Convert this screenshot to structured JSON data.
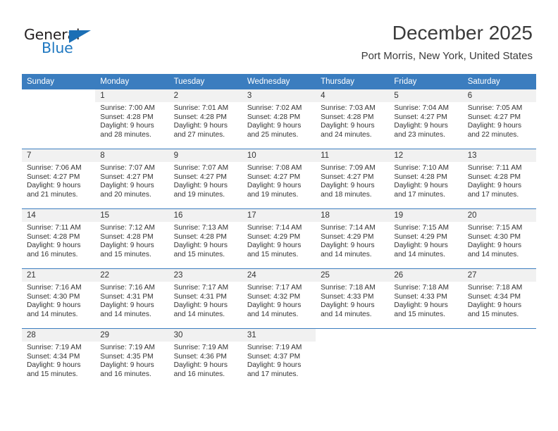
{
  "brand": {
    "name_part1": "General",
    "name_part2": "Blue",
    "accent_color": "#1b6fb5"
  },
  "header": {
    "title": "December 2025",
    "subtitle": "Port Morris, New York, United States"
  },
  "calendar": {
    "header_color": "#3b7dbf",
    "daynum_band_color": "#f1f1f1",
    "weekday_names": [
      "Sunday",
      "Monday",
      "Tuesday",
      "Wednesday",
      "Thursday",
      "Friday",
      "Saturday"
    ],
    "weeks": [
      [
        {
          "day": "",
          "lines": []
        },
        {
          "day": "1",
          "lines": [
            "Sunrise: 7:00 AM",
            "Sunset: 4:28 PM",
            "Daylight: 9 hours",
            "and 28 minutes."
          ]
        },
        {
          "day": "2",
          "lines": [
            "Sunrise: 7:01 AM",
            "Sunset: 4:28 PM",
            "Daylight: 9 hours",
            "and 27 minutes."
          ]
        },
        {
          "day": "3",
          "lines": [
            "Sunrise: 7:02 AM",
            "Sunset: 4:28 PM",
            "Daylight: 9 hours",
            "and 25 minutes."
          ]
        },
        {
          "day": "4",
          "lines": [
            "Sunrise: 7:03 AM",
            "Sunset: 4:28 PM",
            "Daylight: 9 hours",
            "and 24 minutes."
          ]
        },
        {
          "day": "5",
          "lines": [
            "Sunrise: 7:04 AM",
            "Sunset: 4:27 PM",
            "Daylight: 9 hours",
            "and 23 minutes."
          ]
        },
        {
          "day": "6",
          "lines": [
            "Sunrise: 7:05 AM",
            "Sunset: 4:27 PM",
            "Daylight: 9 hours",
            "and 22 minutes."
          ]
        }
      ],
      [
        {
          "day": "7",
          "lines": [
            "Sunrise: 7:06 AM",
            "Sunset: 4:27 PM",
            "Daylight: 9 hours",
            "and 21 minutes."
          ]
        },
        {
          "day": "8",
          "lines": [
            "Sunrise: 7:07 AM",
            "Sunset: 4:27 PM",
            "Daylight: 9 hours",
            "and 20 minutes."
          ]
        },
        {
          "day": "9",
          "lines": [
            "Sunrise: 7:07 AM",
            "Sunset: 4:27 PM",
            "Daylight: 9 hours",
            "and 19 minutes."
          ]
        },
        {
          "day": "10",
          "lines": [
            "Sunrise: 7:08 AM",
            "Sunset: 4:27 PM",
            "Daylight: 9 hours",
            "and 19 minutes."
          ]
        },
        {
          "day": "11",
          "lines": [
            "Sunrise: 7:09 AM",
            "Sunset: 4:27 PM",
            "Daylight: 9 hours",
            "and 18 minutes."
          ]
        },
        {
          "day": "12",
          "lines": [
            "Sunrise: 7:10 AM",
            "Sunset: 4:28 PM",
            "Daylight: 9 hours",
            "and 17 minutes."
          ]
        },
        {
          "day": "13",
          "lines": [
            "Sunrise: 7:11 AM",
            "Sunset: 4:28 PM",
            "Daylight: 9 hours",
            "and 17 minutes."
          ]
        }
      ],
      [
        {
          "day": "14",
          "lines": [
            "Sunrise: 7:11 AM",
            "Sunset: 4:28 PM",
            "Daylight: 9 hours",
            "and 16 minutes."
          ]
        },
        {
          "day": "15",
          "lines": [
            "Sunrise: 7:12 AM",
            "Sunset: 4:28 PM",
            "Daylight: 9 hours",
            "and 15 minutes."
          ]
        },
        {
          "day": "16",
          "lines": [
            "Sunrise: 7:13 AM",
            "Sunset: 4:28 PM",
            "Daylight: 9 hours",
            "and 15 minutes."
          ]
        },
        {
          "day": "17",
          "lines": [
            "Sunrise: 7:14 AM",
            "Sunset: 4:29 PM",
            "Daylight: 9 hours",
            "and 15 minutes."
          ]
        },
        {
          "day": "18",
          "lines": [
            "Sunrise: 7:14 AM",
            "Sunset: 4:29 PM",
            "Daylight: 9 hours",
            "and 14 minutes."
          ]
        },
        {
          "day": "19",
          "lines": [
            "Sunrise: 7:15 AM",
            "Sunset: 4:29 PM",
            "Daylight: 9 hours",
            "and 14 minutes."
          ]
        },
        {
          "day": "20",
          "lines": [
            "Sunrise: 7:15 AM",
            "Sunset: 4:30 PM",
            "Daylight: 9 hours",
            "and 14 minutes."
          ]
        }
      ],
      [
        {
          "day": "21",
          "lines": [
            "Sunrise: 7:16 AM",
            "Sunset: 4:30 PM",
            "Daylight: 9 hours",
            "and 14 minutes."
          ]
        },
        {
          "day": "22",
          "lines": [
            "Sunrise: 7:16 AM",
            "Sunset: 4:31 PM",
            "Daylight: 9 hours",
            "and 14 minutes."
          ]
        },
        {
          "day": "23",
          "lines": [
            "Sunrise: 7:17 AM",
            "Sunset: 4:31 PM",
            "Daylight: 9 hours",
            "and 14 minutes."
          ]
        },
        {
          "day": "24",
          "lines": [
            "Sunrise: 7:17 AM",
            "Sunset: 4:32 PM",
            "Daylight: 9 hours",
            "and 14 minutes."
          ]
        },
        {
          "day": "25",
          "lines": [
            "Sunrise: 7:18 AM",
            "Sunset: 4:33 PM",
            "Daylight: 9 hours",
            "and 14 minutes."
          ]
        },
        {
          "day": "26",
          "lines": [
            "Sunrise: 7:18 AM",
            "Sunset: 4:33 PM",
            "Daylight: 9 hours",
            "and 15 minutes."
          ]
        },
        {
          "day": "27",
          "lines": [
            "Sunrise: 7:18 AM",
            "Sunset: 4:34 PM",
            "Daylight: 9 hours",
            "and 15 minutes."
          ]
        }
      ],
      [
        {
          "day": "28",
          "lines": [
            "Sunrise: 7:19 AM",
            "Sunset: 4:34 PM",
            "Daylight: 9 hours",
            "and 15 minutes."
          ]
        },
        {
          "day": "29",
          "lines": [
            "Sunrise: 7:19 AM",
            "Sunset: 4:35 PM",
            "Daylight: 9 hours",
            "and 16 minutes."
          ]
        },
        {
          "day": "30",
          "lines": [
            "Sunrise: 7:19 AM",
            "Sunset: 4:36 PM",
            "Daylight: 9 hours",
            "and 16 minutes."
          ]
        },
        {
          "day": "31",
          "lines": [
            "Sunrise: 7:19 AM",
            "Sunset: 4:37 PM",
            "Daylight: 9 hours",
            "and 17 minutes."
          ]
        },
        {
          "day": "",
          "lines": []
        },
        {
          "day": "",
          "lines": []
        },
        {
          "day": "",
          "lines": []
        }
      ]
    ]
  }
}
